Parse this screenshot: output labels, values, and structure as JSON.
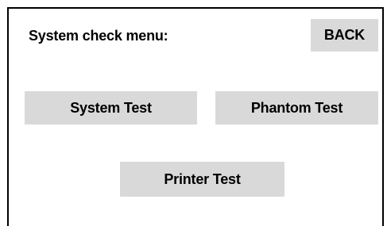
{
  "menu": {
    "title": "System check menu:",
    "back_label": "BACK"
  },
  "buttons": {
    "system_test": "System Test",
    "phantom_test": "Phantom Test",
    "printer_test": "Printer Test"
  },
  "colors": {
    "button_bg": "#d9d9d9",
    "border": "#000000",
    "background": "#ffffff"
  }
}
